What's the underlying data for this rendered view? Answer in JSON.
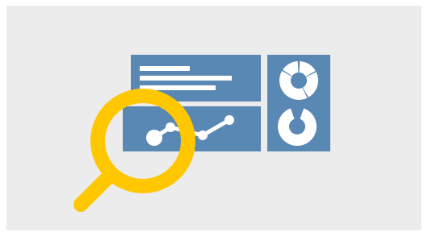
{
  "illustration": {
    "colors": {
      "page": "#ffffff",
      "backdrop": "#ececec",
      "panel": "#5a88b4",
      "panel_marks": "#ffffff",
      "magnifier": "#ffc700"
    },
    "icons": {
      "magnifier": "magnifying-glass-icon",
      "line_chart": "line-chart-icon",
      "donut_top": "donut-chart-icon",
      "donut_bottom": "ring-chart-icon",
      "text_lines": "text-lines-icon"
    }
  }
}
